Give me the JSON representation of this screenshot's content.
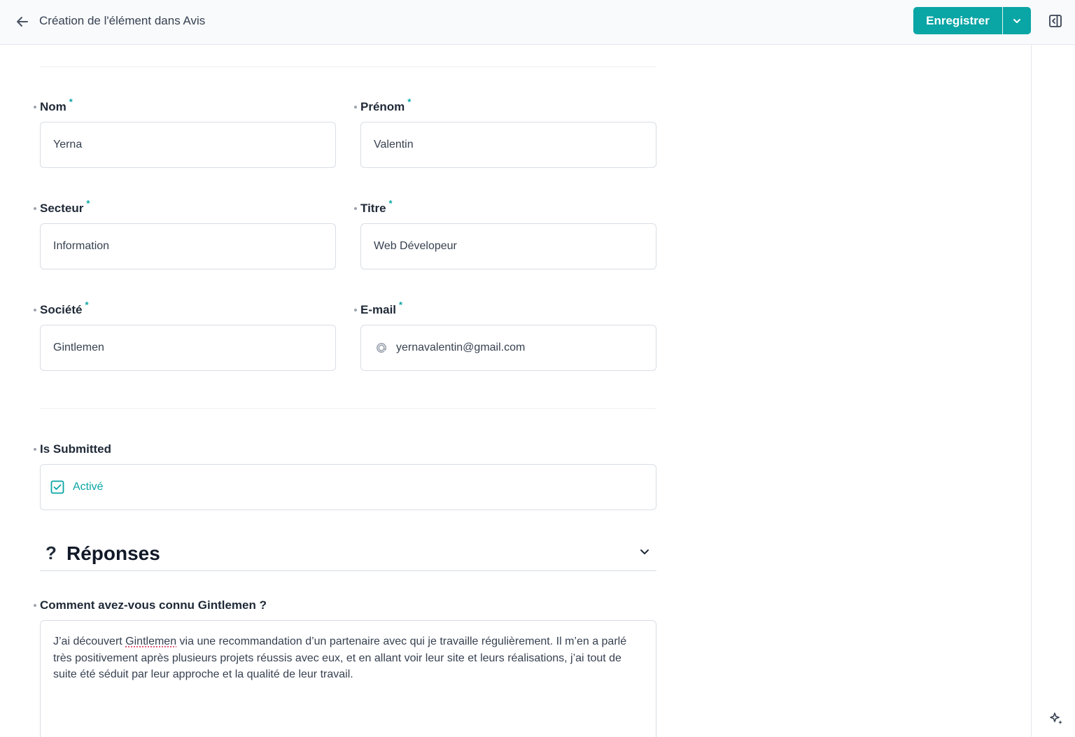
{
  "header": {
    "title": "Création de l'élément dans Avis",
    "save_label": "Enregistrer"
  },
  "colors": {
    "accent": "#0aa5a5",
    "text": "#1f2937",
    "border": "#d9dde3"
  },
  "icons": {
    "back": "arrow-left-icon",
    "save_menu": "chevron-down-icon",
    "panel": "sidebar-toggle-icon",
    "email": "at-icon",
    "checkbox": "checkbox-checked-icon",
    "section": "question-mark-icon",
    "collapse": "chevron-down-icon",
    "assistant": "sparkle-icon"
  },
  "form": {
    "nom": {
      "label": "Nom",
      "required": "*",
      "value": "Yerna"
    },
    "prenom": {
      "label": "Prénom",
      "required": "*",
      "value": "Valentin"
    },
    "secteur": {
      "label": "Secteur",
      "required": "*",
      "value": "Information"
    },
    "titre": {
      "label": "Titre",
      "required": "*",
      "value": "Web Dévelopeur"
    },
    "societe": {
      "label": "Société",
      "required": "*",
      "value": "Gintlemen"
    },
    "email": {
      "label": "E-mail",
      "required": "*",
      "value": "yernavalentin@gmail.com"
    },
    "is_submitted": {
      "label": "Is Submitted",
      "value": "Activé",
      "checked": true
    }
  },
  "reponses": {
    "section_mark": "?",
    "title": "Réponses",
    "question": {
      "label": "Comment avez-vous connu Gintlemen ?",
      "answer_before": "J’ai découvert ",
      "answer_flagged_word": "Gintlemen",
      "answer_after": " via une recommandation d’un partenaire avec qui je travaille régulièrement. Il m’en a parlé très positivement après plusieurs projets réussis avec eux, et en allant voir leur site et leurs réalisations, j’ai tout de suite été séduit par leur approche et la qualité de leur travail."
    }
  }
}
